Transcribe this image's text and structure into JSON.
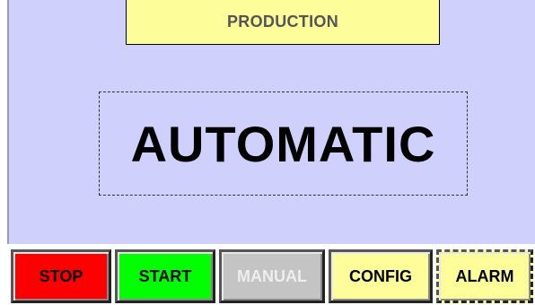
{
  "header": {
    "title": "PRODUCTION"
  },
  "mode": {
    "label": "AUTOMATIC"
  },
  "buttons": {
    "stop": "STOP",
    "start": "START",
    "manual": "MANUAL",
    "config": "CONFIG",
    "alarm": "ALARM"
  },
  "colors": {
    "panel_background": "#cfd0fb",
    "title_background": "#fdfd9a",
    "stop": "#ff0000",
    "start": "#00ff00",
    "manual_disabled": "#c4c4c4",
    "config": "#fdfd9a",
    "alarm": "#fdfd9a"
  }
}
